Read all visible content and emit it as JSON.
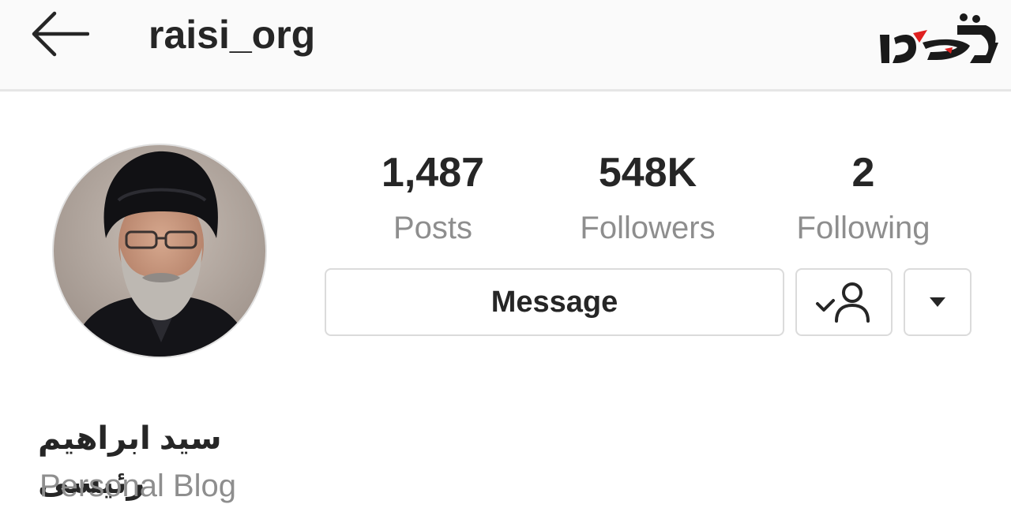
{
  "header": {
    "back_icon": "arrow-left-icon",
    "username": "raisi_org",
    "watermark_icon": "site-logo-watermark"
  },
  "profile": {
    "avatar_icon": "profile-photo",
    "stats": [
      {
        "value": "1,487",
        "label": "Posts"
      },
      {
        "value": "548K",
        "label": "Followers"
      },
      {
        "value": "2",
        "label": "Following"
      }
    ],
    "buttons": {
      "message_label": "Message",
      "following_icon": "person-check-icon",
      "dropdown_icon": "caret-down-icon"
    },
    "full_name": "سید ابراهیم رئیسی",
    "category": "Personal Blog"
  },
  "colors": {
    "text_primary": "#262626",
    "text_secondary": "#8e8e8e",
    "border": "#dbdbdb",
    "header_bg": "#fafafa",
    "watermark_red": "#e0201f"
  }
}
